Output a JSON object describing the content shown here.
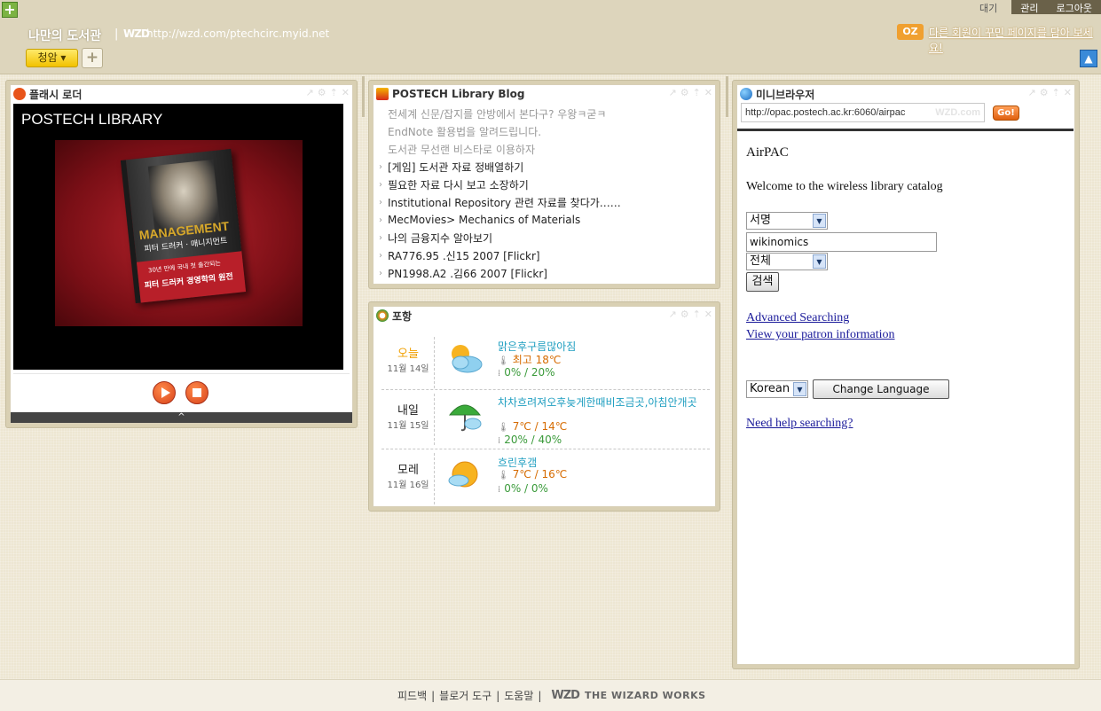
{
  "header": {
    "add_glyph": "+",
    "site_title": "나만의 도서관",
    "title_separator": "|",
    "logo_text": "WZD",
    "site_url": "http://wzd.com/ptechcirc.myid.net",
    "tabs": [
      "대기",
      "관리",
      "로그아웃"
    ],
    "oz_badge": "OZ",
    "promo": "다른 회원이 꾸민 페이지를 담아 보세요!",
    "page_tab_label": "청암 ▾",
    "add_tab_glyph": "+",
    "scroll_top_glyph": "▲"
  },
  "flash_widget": {
    "title": "플래시 로더",
    "stage_title": "POSTECH LIBRARY",
    "book": {
      "title": "MANAGEMENT",
      "subtitle": "피터 드러커 · 매니지먼트",
      "band_small": "30년 만에 국내 첫 출간되는",
      "band_big": "피터 드러커 경영학의 원전"
    },
    "collapse_glyph": "^"
  },
  "blog_widget": {
    "title": "POSTECH Library Blog",
    "items": [
      {
        "text": "전세계 신문/잡지를 안방에서 본다구? 우왕ㅋ굳ㅋ",
        "read": true
      },
      {
        "text": "EndNote 활용법을 알려드립니다.",
        "read": true
      },
      {
        "text": "도서관 무선랜 비스타로 이용하자",
        "read": true
      },
      {
        "text": "[게임] 도서관 자료 정배열하기",
        "read": false
      },
      {
        "text": "필요한 자료 다시 보고 소장하기",
        "read": false
      },
      {
        "text": "Institutional Repository 관련 자료를 찾다가……",
        "read": false
      },
      {
        "text": "MecMovies> Mechanics of Materials",
        "read": false
      },
      {
        "text": "나의 금융지수 알아보기",
        "read": false
      },
      {
        "text": "RA776.95 .신15 2007 [Flickr]",
        "read": false
      },
      {
        "text": "PN1998.A2 .김66 2007 [Flickr]",
        "read": false
      }
    ]
  },
  "weather_widget": {
    "title": "포항",
    "days": [
      {
        "day": "오늘",
        "date": "11월 14일",
        "condition": "맑은후구름많아짐",
        "temp": "최고 18℃",
        "rain": "0% / 20%",
        "icon": "sun-cloud-icon"
      },
      {
        "day": "내일",
        "date": "11월 15일",
        "condition": "차차흐려져오후늦게한때비조금곳,아침안개곳",
        "temp": "7℃ / 14℃",
        "rain": "20% / 40%",
        "icon": "umbrella-icon"
      },
      {
        "day": "모레",
        "date": "11월 16일",
        "condition": "흐린후갬",
        "temp": "7℃ / 16℃",
        "rain": "0% / 0%",
        "icon": "cloud-sun-icon"
      }
    ]
  },
  "mini_browser": {
    "title": "미니브라우저",
    "address": "http://opac.postech.ac.kr:6060/airpac",
    "watermark": "WZD.com",
    "go_label": "Go!",
    "page": {
      "heading": "AirPAC",
      "welcome": "Welcome to the wireless library catalog",
      "search_type": "서명",
      "search_value": "wikinomics",
      "scope": "전체",
      "search_button": "검색",
      "advanced_link": "Advanced Searching",
      "patron_link": "View your patron information",
      "language": "Korean",
      "change_language_button": "Change Language",
      "help_link": "Need help searching?"
    }
  },
  "footer": {
    "links": [
      "피드백",
      "블로거 도구",
      "도움말"
    ],
    "separator": "|",
    "brand_logo": "WZD",
    "brand": "THE WIZARD WORKS"
  },
  "colors": {
    "header_bg": "#ddd5bc",
    "accent_orange": "#f0a030",
    "weather_condition": "#1e9ec0",
    "weather_temp": "#d66b00",
    "weather_rain": "#3a9a3a"
  }
}
